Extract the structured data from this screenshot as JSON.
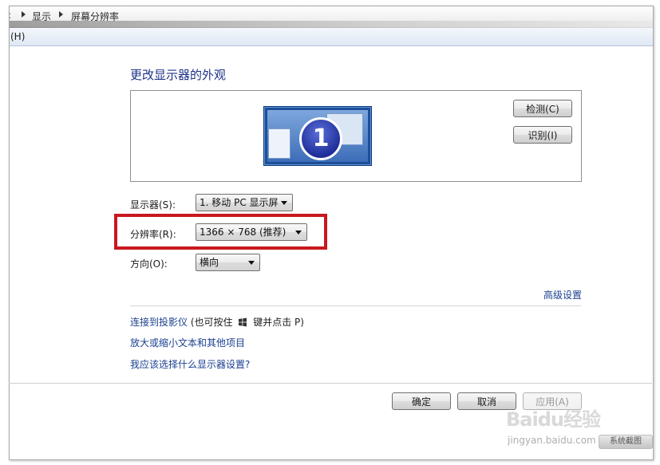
{
  "breadcrumb": {
    "item1": "显示",
    "item2": "屏幕分辨率"
  },
  "menu": {
    "help": "(H)"
  },
  "main": {
    "title": "更改显示器的外观",
    "monitor_number": "1",
    "detect_button": "检测(C)",
    "identify_button": "识别(I)",
    "display_label": "显示器(S):",
    "display_value": "1. 移动 PC 显示屏",
    "resolution_label": "分辨率(R):",
    "resolution_value": "1366 × 768 (推荐)",
    "orientation_label": "方向(O):",
    "orientation_value": "横向",
    "advanced_link": "高级设置",
    "projector_link": "连接到投影仪",
    "projector_hint_pre": "(也可按住",
    "projector_hint_post": "键并点击 P)",
    "text_size_link": "放大或缩小文本和其他项目",
    "which_settings_link": "我应该选择什么显示器设置?"
  },
  "footer": {
    "ok_button": "确定",
    "cancel_button": "取消",
    "apply_button": "应用(A)"
  },
  "watermark": {
    "logo": "Baidu经验",
    "url": "jingyan.baidu.com",
    "tag": "系统截图"
  },
  "colors": {
    "heading": "#1e3287",
    "link": "#1a3f8f",
    "highlight_box": "#c8181f"
  }
}
